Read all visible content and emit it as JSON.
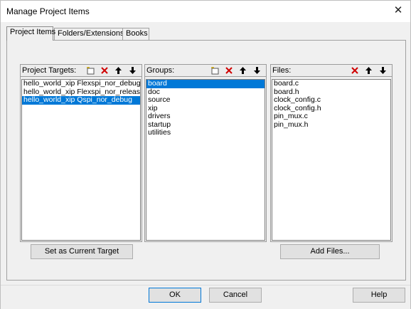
{
  "window": {
    "title": "Manage Project Items",
    "close_glyph": "✕"
  },
  "tabs": [
    {
      "label": "Project Items",
      "active": true
    },
    {
      "label": "Folders/Extensions",
      "active": false
    },
    {
      "label": "Books",
      "active": false
    }
  ],
  "targets": {
    "label": "Project Targets:",
    "items": [
      "hello_world_xip Flexspi_nor_debug",
      "hello_world_xip Flexspi_nor_release",
      "hello_world_xip Qspi_nor_debug"
    ],
    "selected_index": 2
  },
  "groups": {
    "label": "Groups:",
    "items": [
      "board",
      "doc",
      "source",
      "xip",
      "drivers",
      "startup",
      "utilities"
    ],
    "selected_index": 0
  },
  "files": {
    "label": "Files:",
    "items": [
      "board.c",
      "board.h",
      "clock_config.c",
      "clock_config.h",
      "pin_mux.c",
      "pin_mux.h"
    ]
  },
  "buttons": {
    "set_current_target": "Set as Current Target",
    "add_files": "Add Files...",
    "ok": "OK",
    "cancel": "Cancel",
    "help": "Help"
  },
  "colors": {
    "selection": "#0078d7",
    "delete": "#d00000"
  },
  "icons": [
    "new-item-icon",
    "delete-icon",
    "move-up-icon",
    "move-down-icon"
  ]
}
